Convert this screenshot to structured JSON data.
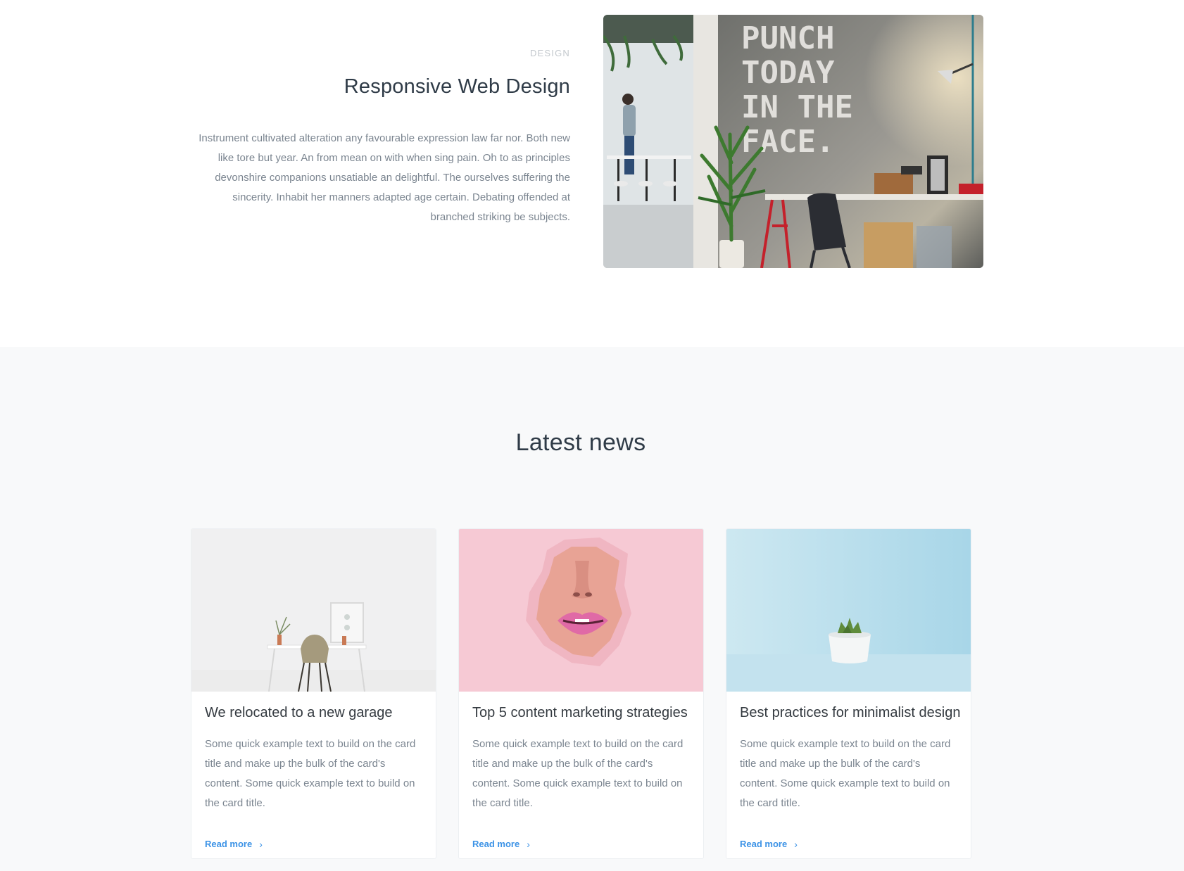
{
  "feature": {
    "eyebrow": "DESIGN",
    "title": "Responsive Web Design",
    "description": "Instrument cultivated alteration any favourable expression law far nor. Both new like tore but year. An from mean on with when sing pain. Oh to as principles devonshire companions unsatiable an delightful. The ourselves suffering the sincerity. Inhabit her manners adapted age certain. Debating offended at branched striking be subjects.",
    "image": {
      "wall_text_line1": "PUNCH",
      "wall_text_line2": "TODAY",
      "wall_text_line3": "IN THE",
      "wall_text_line4": "FACE."
    }
  },
  "news": {
    "title": "Latest news",
    "cards": [
      {
        "title": "We relocated to a new garage",
        "text": "Some quick example text to build on the card title and make up the bulk of the card's content. Some quick example text to build on the card title.",
        "link": "Read more",
        "icon": "chevron-right-icon"
      },
      {
        "title": "Top 5 content marketing strategies",
        "text": "Some quick example text to build on the card title and make up the bulk of the card's content. Some quick example text to build on the card title.",
        "link": "Read more",
        "icon": "chevron-right-icon"
      },
      {
        "title": "Best practices for minimalist design",
        "text": "Some quick example text to build on the card title and make up the bulk of the card's content. Some quick example text to build on the card title.",
        "link": "Read more",
        "icon": "chevron-right-icon"
      }
    ]
  },
  "colors": {
    "link": "#3d93e6",
    "heading": "#2f3b47",
    "body_text": "#7b8590",
    "section_bg": "#f8f9fa"
  }
}
